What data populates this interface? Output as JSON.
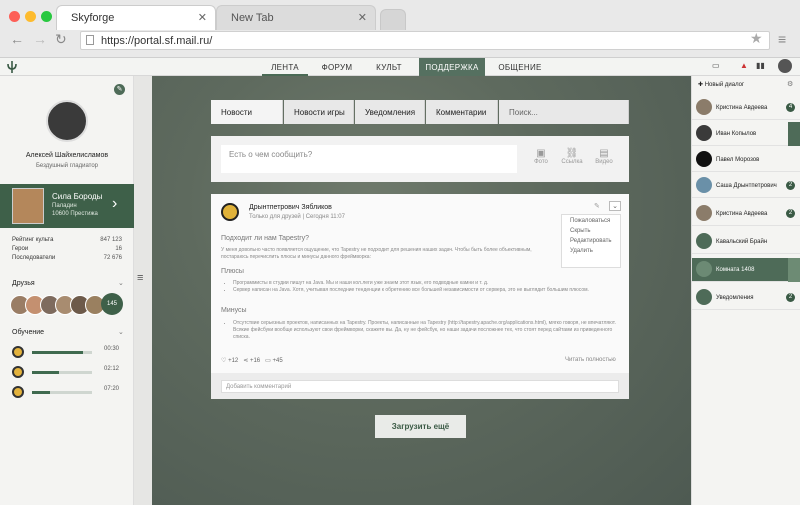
{
  "browser": {
    "tabs": [
      {
        "title": "Skyforge"
      },
      {
        "title": "New Tab"
      }
    ],
    "url": "https://portal.sf.mail.ru/"
  },
  "nav": {
    "items": [
      "ЛЕНТА",
      "ФОРУМ",
      "КУЛЬТ",
      "ПОДДЕРЖКА",
      "ОБЩЕНИЕ"
    ]
  },
  "profile": {
    "name": "Алексей Шайхелисламов",
    "title": "Бездушный гладиатор",
    "guild": {
      "name": "Сила Бороды",
      "subtitle": "Паладин",
      "prestige": "10600 Престижа"
    },
    "stats": [
      {
        "label": "Рейтинг культа",
        "value": "847 123"
      },
      {
        "label": "Герои",
        "value": "16"
      },
      {
        "label": "Последователи",
        "value": "72 676"
      }
    ],
    "friends_label": "Друзья",
    "friends_count": "145",
    "learning_label": "Обучение",
    "courses": [
      {
        "time": "00:30",
        "progress": 0.85
      },
      {
        "time": "02:12",
        "progress": 0.45
      },
      {
        "time": "07:20",
        "progress": 0.3
      }
    ]
  },
  "subtabs": [
    "Новости",
    "Новости игры",
    "Уведомления",
    "Комментарии"
  ],
  "search_placeholder": "Поиск...",
  "composer": {
    "placeholder": "Есть о чем сообщить?",
    "actions": [
      "Фото",
      "Ссылка",
      "Видео"
    ]
  },
  "post": {
    "author": "Дрынтпетрович Зябликов",
    "audience": "Только для друзей",
    "date": "Сегодня 11:07",
    "heading": "Подходит ли нам Tapestry?",
    "intro": "У меня довольно часто появляется ощущение, что Tapestry не подходит для решения наших задач. Чтобы быть более объективным, постараюсь перечислить плюсы и минусы данного фреймворка:",
    "pros_title": "Плюсы",
    "pros": [
      "Программисты в студии пишут на Java. Мы и наши кол.леги уже знаем этот язык, его подводные камни и т. д.",
      "Сервер написан на Java. Хотя, учитывая последние тенденции к обретению все большей независимости от сервера, это не выглядит большим плюсом."
    ],
    "cons_title": "Минусы",
    "cons": [
      "Отсутствие серьезных проектов, написанных на Tapestry. Проекты, написанные на Tapestry (http://tapestry.apache.org/applications.html), мягко говоря, не впечатляют. Всякие фейсбуки вообще используют свои фреймворки, скажете вы. Да, ну не фейсбук, но наши задачи посложнее тех, что стоят перед сайтами из приведенного списка."
    ],
    "likes": "+12",
    "shares": "+16",
    "comments": "+45",
    "read_more": "Читать полностью",
    "menu": [
      "Пожаловаться",
      "Скрыть",
      "Редактировать",
      "Удалить"
    ],
    "comment_placeholder": "Добавить комментарий"
  },
  "load_more": "Загрузить ещё",
  "right": {
    "new_dialog": "Новый диалог",
    "items": [
      {
        "name": "Кристина Авдеева",
        "badge": "4"
      },
      {
        "name": "Иван Копылов",
        "badge": ""
      },
      {
        "name": "Павел Морозов",
        "badge": ""
      },
      {
        "name": "Саша Дрынтпетрович",
        "badge": "2"
      },
      {
        "name": "Кристина Авдеева",
        "badge": "2"
      },
      {
        "name": "Кавальский Брайн",
        "badge": ""
      },
      {
        "name": "Комната 1408",
        "badge": ""
      },
      {
        "name": "Уведомления",
        "badge": "2"
      }
    ]
  },
  "colors": {
    "accent": "#4e6b58",
    "dark": "#3a5a45"
  }
}
